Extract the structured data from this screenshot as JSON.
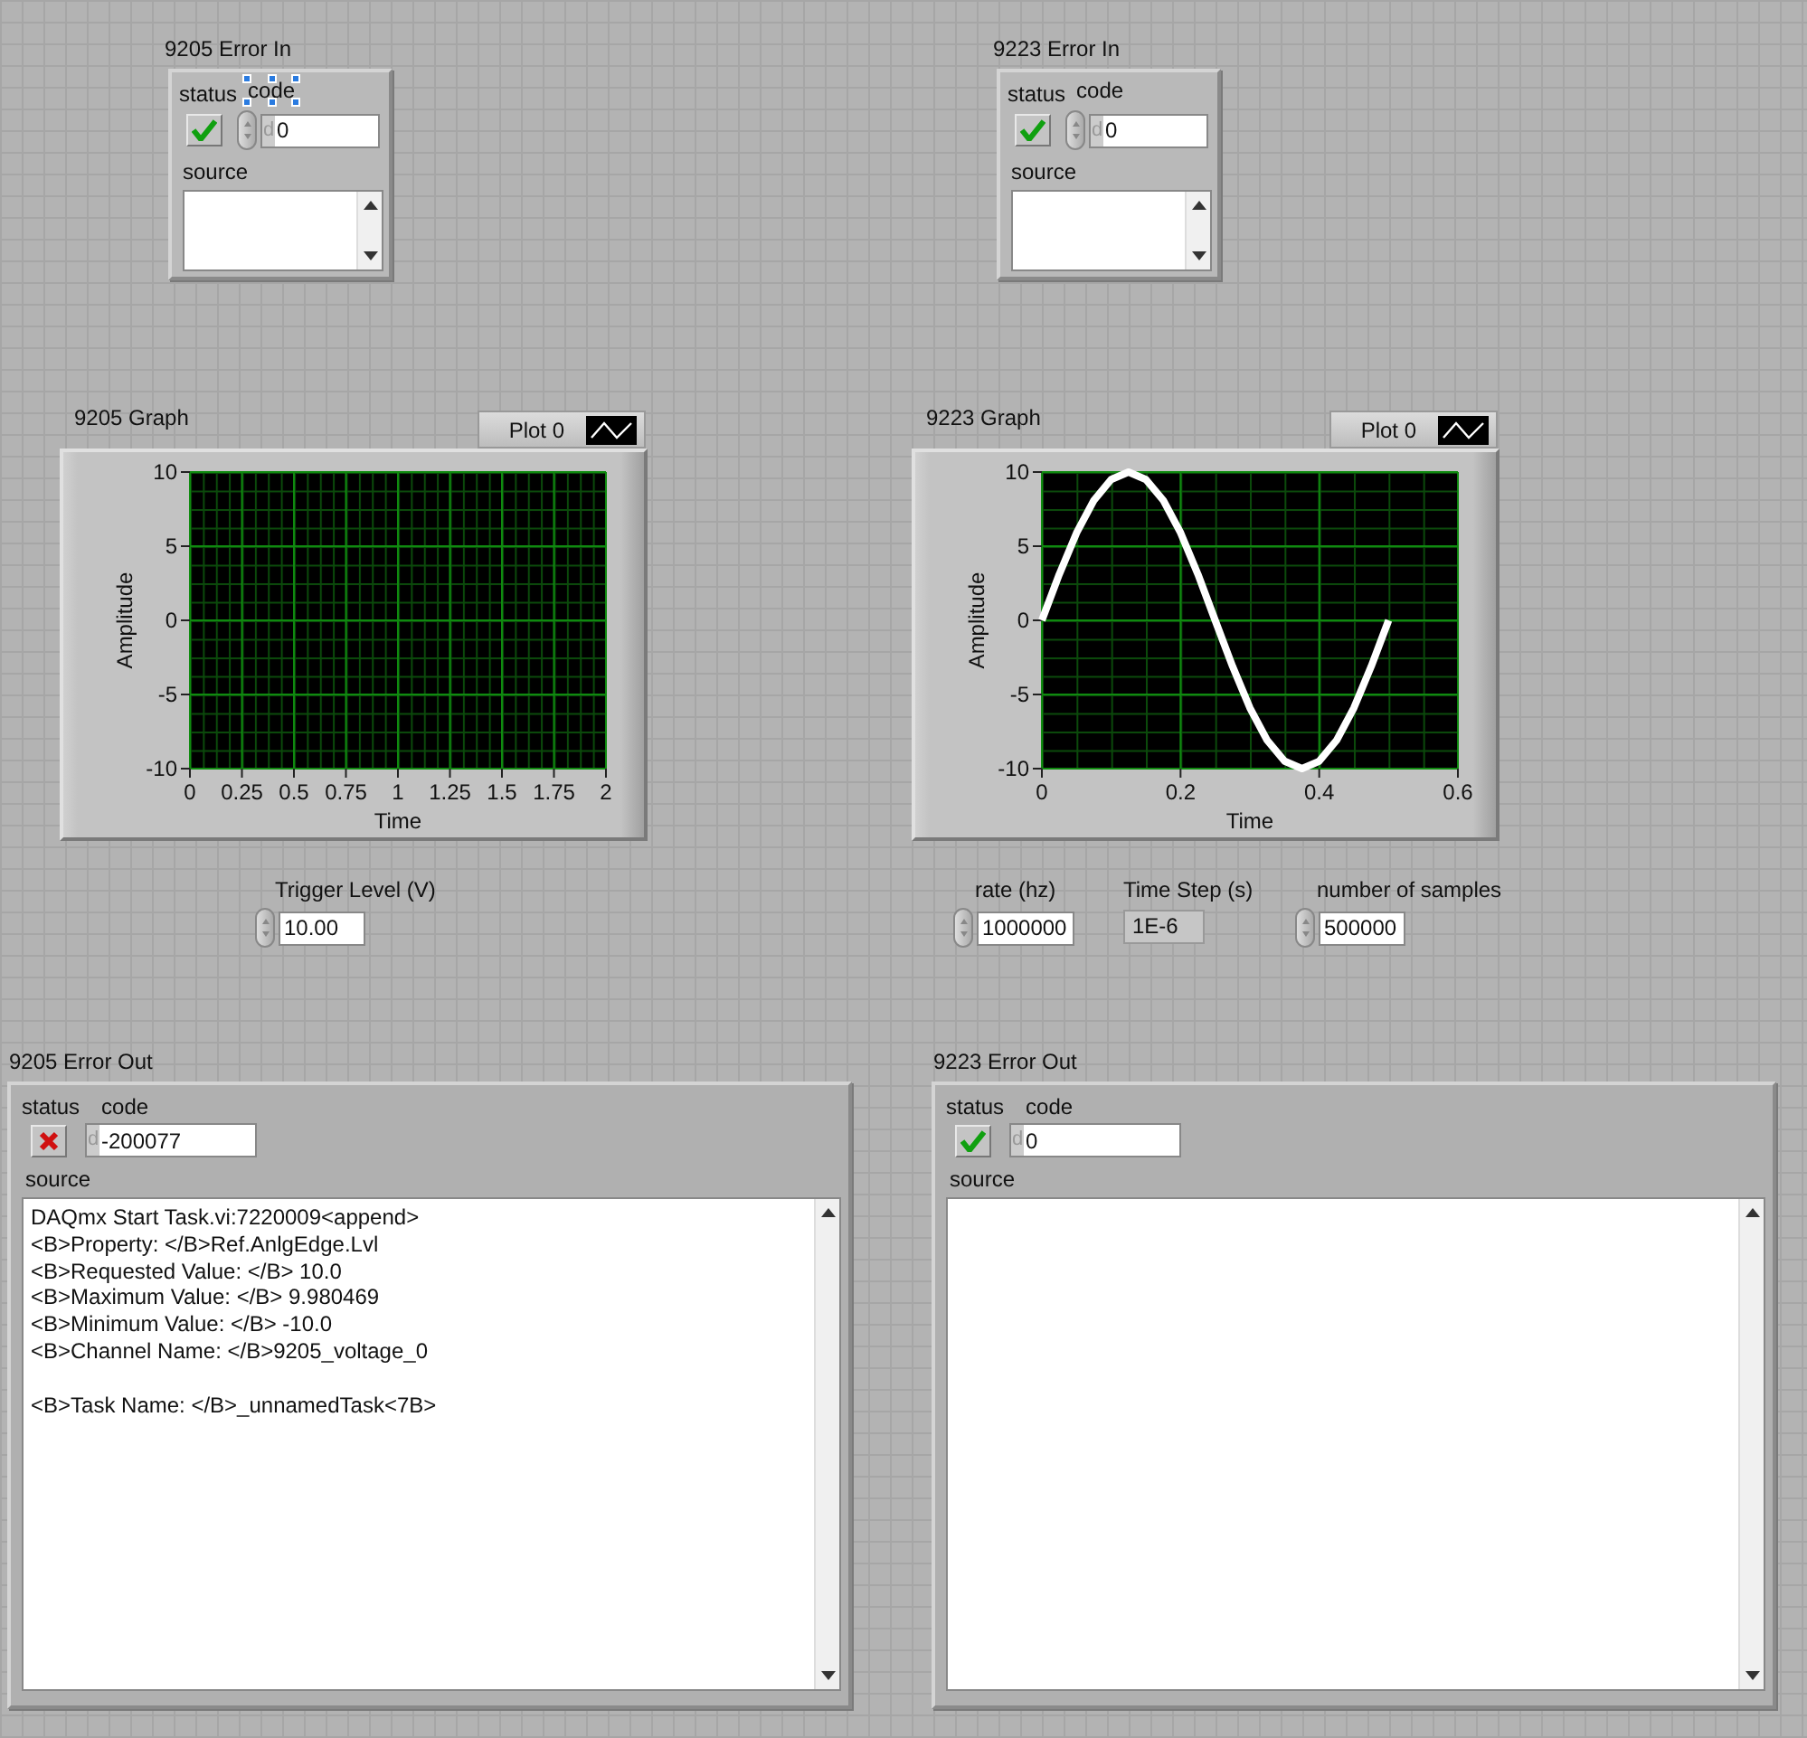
{
  "errors_in": [
    {
      "label": "9205 Error In",
      "status_label": "status",
      "status": true,
      "code_label": "code",
      "code_label_selected": true,
      "radix": "d",
      "code": "0",
      "source_label": "source"
    },
    {
      "label": "9223 Error In",
      "status_label": "status",
      "status": true,
      "code_label": "code",
      "code_label_selected": false,
      "radix": "d",
      "code": "0",
      "source_label": "source"
    }
  ],
  "graphs": [
    {
      "title": "9205 Graph",
      "legend": "Plot 0",
      "chart_data": {
        "type": "line",
        "grid": true,
        "xlabel": "Time",
        "ylabel": "Amplitude",
        "xlim": [
          0,
          2
        ],
        "ylim": [
          -10,
          10
        ],
        "xticks": [
          0,
          0.25,
          0.5,
          0.75,
          1,
          1.25,
          1.5,
          1.75,
          2
        ],
        "yticks": [
          -10,
          -5,
          0,
          5,
          10
        ]
      }
    },
    {
      "title": "9223 Graph",
      "chart_data": {
        "type": "line",
        "grid": true,
        "xlabel": "Time",
        "ylabel": "Amplitude",
        "xlim": [
          0,
          0.6
        ],
        "ylim": [
          -10,
          10
        ],
        "xticks": [
          0,
          0.2,
          0.4,
          0.6
        ],
        "yticks": [
          -10,
          -5,
          0,
          5,
          10
        ],
        "x": [
          0,
          0.025,
          0.05,
          0.075,
          0.1,
          0.125,
          0.15,
          0.175,
          0.2,
          0.225,
          0.25,
          0.275,
          0.3,
          0.325,
          0.35,
          0.375,
          0.4,
          0.425,
          0.45,
          0.475,
          0.5
        ],
        "series": [
          {
            "name": "Plot 0",
            "color": "#ffffff",
            "values": [
              0,
              3.1,
              5.9,
              8.1,
              9.5,
              10,
              9.5,
              8.1,
              5.9,
              3.1,
              0,
              -3.1,
              -5.9,
              -8.1,
              -9.5,
              -10,
              -9.5,
              -8.1,
              -5.9,
              -3.1,
              0
            ]
          }
        ]
      }
    }
  ],
  "controls": [
    {
      "kind": "control",
      "label": "Trigger Level (V)",
      "value": "10.00"
    },
    {
      "kind": "control",
      "label": "rate (hz)",
      "value": "1000000"
    },
    {
      "kind": "indicator",
      "label": "Time Step (s)",
      "value": "1E-6"
    },
    {
      "kind": "control",
      "label": "number of samples",
      "value": "500000"
    }
  ],
  "errors_out": [
    {
      "label": "9205 Error Out",
      "status_label": "status",
      "status": false,
      "code_label": "code",
      "radix": "d",
      "code": "-200077",
      "source_label": "source",
      "source": "DAQmx Start Task.vi:7220009<append>\n<B>Property: </B>Ref.AnlgEdge.Lvl\n<B>Requested Value: </B> 10.0\n<B>Maximum Value: </B> 9.980469\n<B>Minimum Value: </B> -10.0\n<B>Channel Name: </B>9205_voltage_0\n\n<B>Task Name: </B>_unnamedTask<7B>"
    },
    {
      "label": "9223 Error Out",
      "status_label": "status",
      "status": true,
      "code_label": "code",
      "radix": "d",
      "code": "0",
      "source_label": "source"
    }
  ]
}
